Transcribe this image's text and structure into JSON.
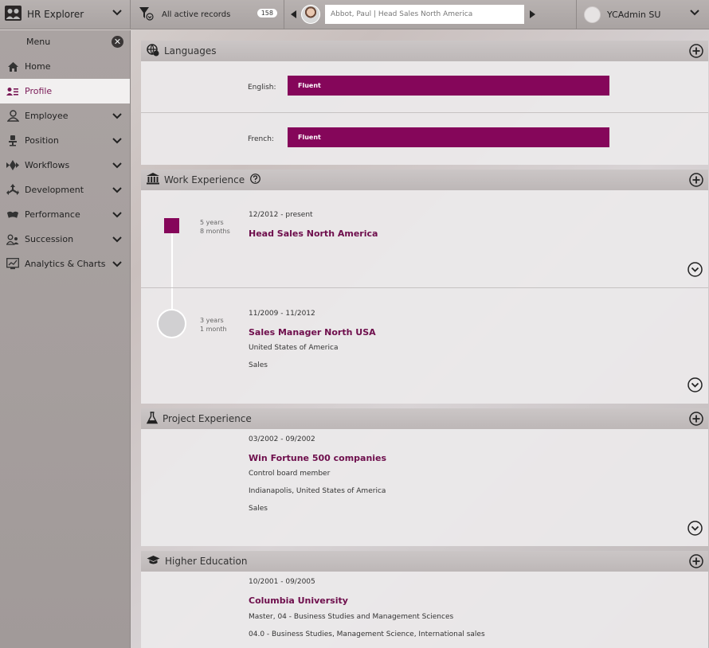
{
  "topbar": {
    "app_name": "HR Explorer",
    "filter_label": "All active records",
    "record_count": "158",
    "current_record": "Abbot, Paul | Head Sales North America",
    "user_name": "YCAdmin SU"
  },
  "sidebar": {
    "menu_label": "Menu",
    "close_symbol": "✕",
    "items": [
      {
        "label": "Home",
        "icon": "home-icon"
      },
      {
        "label": "Profile",
        "icon": "profile-icon"
      },
      {
        "label": "Employee",
        "icon": "employee-icon"
      },
      {
        "label": "Position",
        "icon": "chair-icon"
      },
      {
        "label": "Workflows",
        "icon": "workflow-icon"
      },
      {
        "label": "Development",
        "icon": "development-icon"
      },
      {
        "label": "Performance",
        "icon": "performance-icon"
      },
      {
        "label": "Succession",
        "icon": "succession-icon"
      },
      {
        "label": "Analytics & Charts",
        "icon": "chart-icon"
      }
    ]
  },
  "languages": {
    "title": "Languages",
    "rows": [
      {
        "label": "English:",
        "level": "Fluent"
      },
      {
        "label": "French:",
        "level": "Fluent"
      }
    ]
  },
  "work_experience": {
    "title": "Work Experience",
    "entries": [
      {
        "duration_years": "5 years",
        "duration_months": "8 months",
        "dates": "12/2012 - present",
        "title": "Head Sales North America"
      },
      {
        "duration_years": "3 years",
        "duration_months": "1 month",
        "dates": "11/2009 - 11/2012",
        "title": "Sales Manager North USA",
        "country": "United States of America",
        "department": "Sales"
      }
    ]
  },
  "project_experience": {
    "title": "Project Experience",
    "entries": [
      {
        "dates": "03/2002 - 09/2002",
        "title": "Win Fortune 500 companies",
        "role": "Control board member",
        "location": "Indianapolis, United States of America",
        "department": "Sales"
      }
    ]
  },
  "higher_education": {
    "title": "Higher Education",
    "entries": [
      {
        "dates": "10/2001 - 09/2005",
        "title": "Columbia University",
        "degree": "Master, 04 - Business Studies and Management Sciences",
        "field": "04.0 - Business Studies, Management Science, International sales"
      }
    ]
  },
  "colors": {
    "accent": "#85065a",
    "title_text": "#6e0e4c"
  }
}
